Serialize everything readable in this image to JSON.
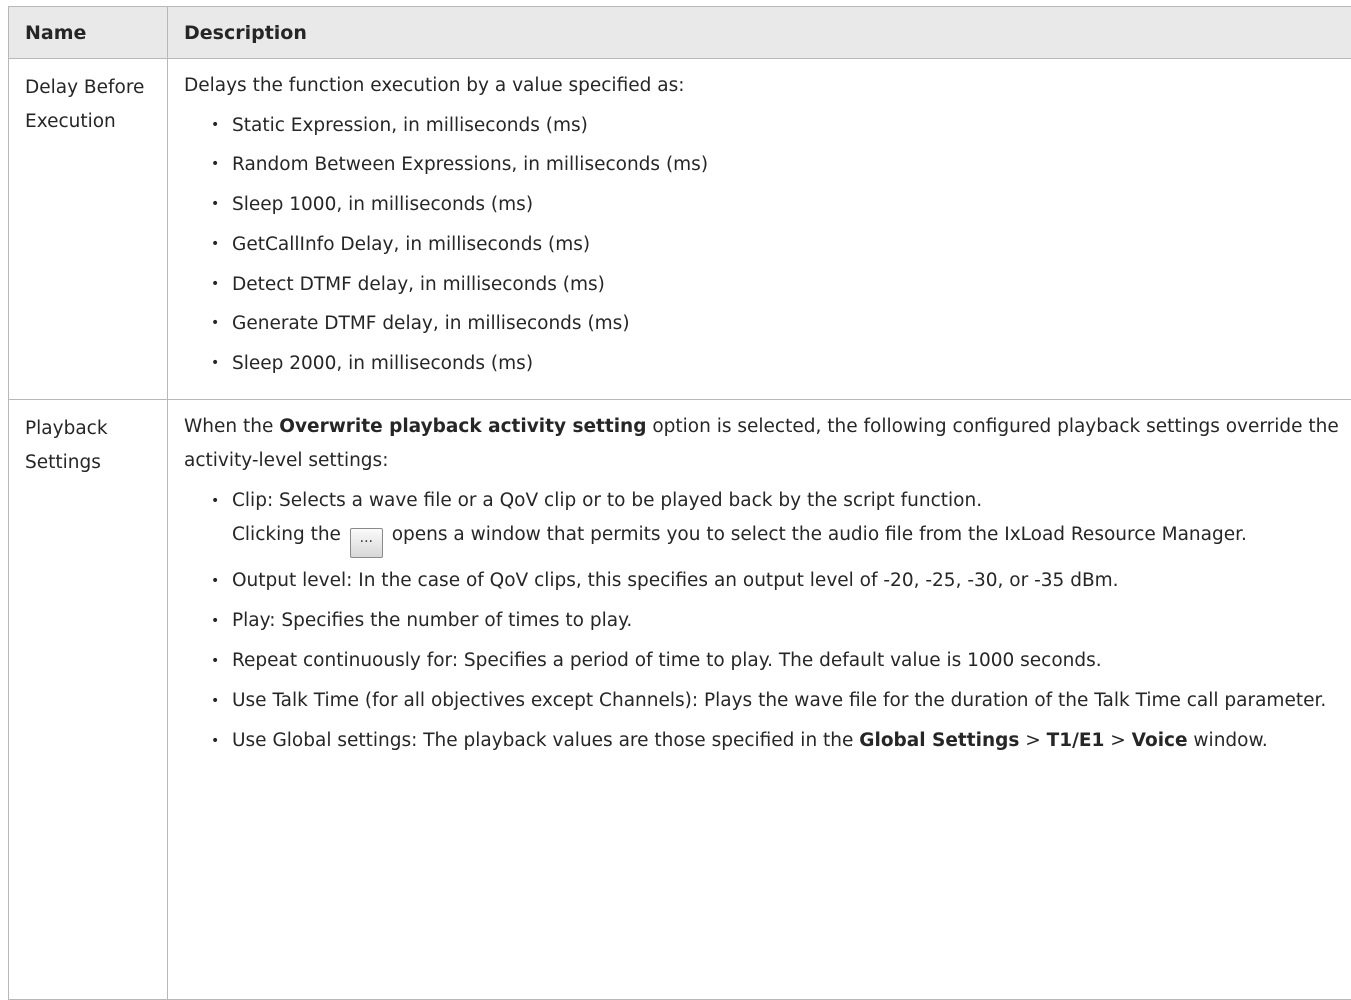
{
  "table": {
    "headers": {
      "name": "Name",
      "description": "Description"
    },
    "rows": [
      {
        "name": "Delay Before Execution",
        "intro": "Delays the function execution by a value specified as:",
        "items": [
          "Static Expression, in milliseconds (ms)",
          "Random Between Expressions, in milliseconds (ms)",
          "Sleep 1000, in milliseconds (ms)",
          "GetCallInfo Delay, in milliseconds (ms)",
          "Detect DTMF delay, in milliseconds (ms)",
          "Generate DTMF delay, in milliseconds (ms)",
          "Sleep 2000, in milliseconds (ms)"
        ]
      },
      {
        "name": "Playback Settings",
        "intro_before": "When the ",
        "intro_bold": "Overwrite playback activity setting",
        "intro_after": " option is selected, the following configured playback settings override the activity-level settings:",
        "clip_item_line1": "Clip: Selects a wave file or a QoV clip or to be played back by the script function.",
        "clip_item_before_button": "Clicking the ",
        "clip_button_glyph": "...",
        "clip_item_after_button": " opens a window that permits you to select the audio file from the IxLoad Resource Manager.",
        "output_level": "Output level: In the case of QoV clips, this specifies an output level of -20, -25, -30, or -35 dBm.",
        "play": "Play: Specifies the number of times to play.",
        "repeat": "Repeat continuously for: Specifies a period of time to play. The default value is 1000 seconds.",
        "talk_time": "Use Talk Time (for all objectives except Channels): Plays the wave file for the duration of the Talk Time call parameter.",
        "global_before": "Use Global settings: The playback values are those specified in the ",
        "global_bold1": "Global Settings",
        "global_sep1": " > ",
        "global_bold2": "T1/E1",
        "global_sep2": " > ",
        "global_bold3": "Voice",
        "global_after": " window."
      }
    ]
  },
  "bullet_glyph": "•",
  "colors": {
    "header_bg": "#e9e9e9",
    "border": "#b8b8b8",
    "text": "#262626"
  }
}
